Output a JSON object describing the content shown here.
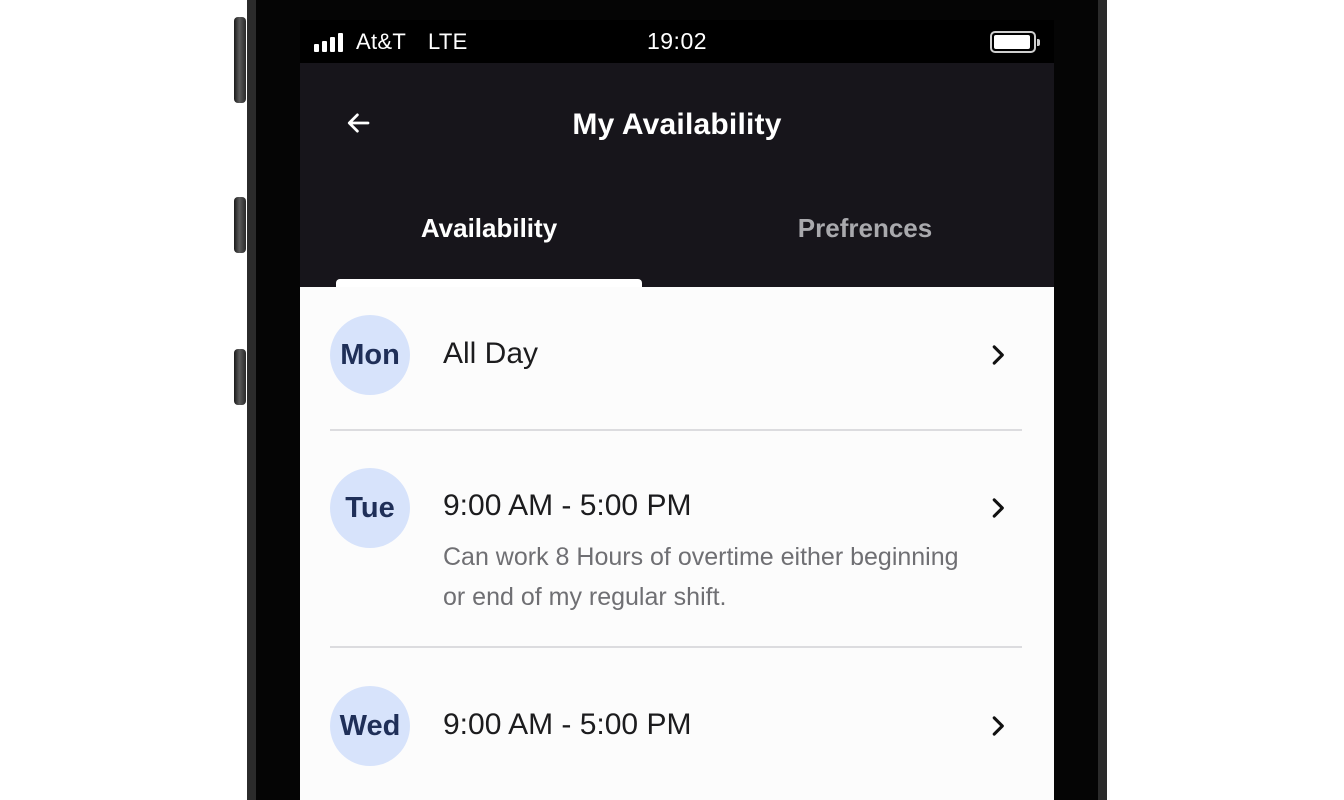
{
  "status_bar": {
    "carrier": "At&T",
    "network": "LTE",
    "time": "19:02"
  },
  "header": {
    "title": "My Availability",
    "back_icon": "arrow-left-icon"
  },
  "tabs": [
    {
      "label": "Availability",
      "active": true
    },
    {
      "label": "Prefrences",
      "active": false
    }
  ],
  "availability": [
    {
      "day": "Mon",
      "time": "All Day",
      "note": ""
    },
    {
      "day": "Tue",
      "time": "9:00 AM - 5:00 PM",
      "note": "Can work 8 Hours of overtime either beginning or end of my regular shift."
    },
    {
      "day": "Wed",
      "time": "9:00 AM - 5:00 PM",
      "note": ""
    }
  ],
  "colors": {
    "header_bg": "#17151b",
    "badge_bg": "#d7e3fb",
    "badge_text": "#1f2f58",
    "inactive_tab": "#a9a9ad"
  }
}
